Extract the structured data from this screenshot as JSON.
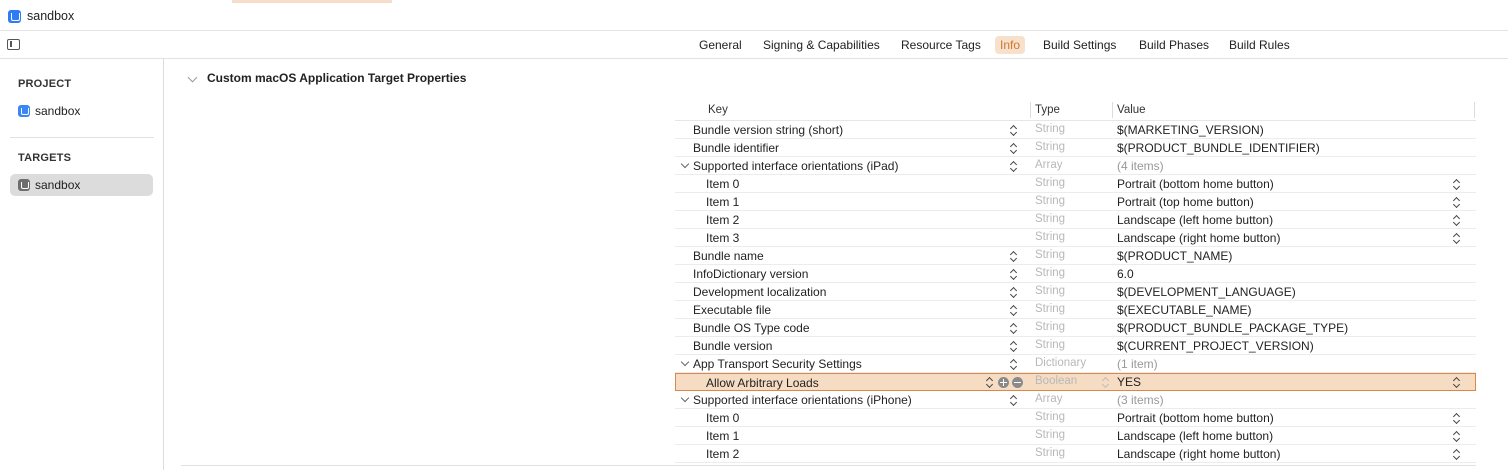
{
  "window": {
    "title": "sandbox"
  },
  "tabs": [
    {
      "label": "General"
    },
    {
      "label": "Signing & Capabilities"
    },
    {
      "label": "Resource Tags"
    },
    {
      "label": "Info"
    },
    {
      "label": "Build Settings"
    },
    {
      "label": "Build Phases"
    },
    {
      "label": "Build Rules"
    }
  ],
  "sidebar": {
    "project_header": "PROJECT",
    "project_item": "sandbox",
    "targets_header": "TARGETS",
    "target_item": "sandbox"
  },
  "section": {
    "title": "Custom macOS Application Target Properties"
  },
  "table": {
    "headers": {
      "key": "Key",
      "type": "Type",
      "value": "Value"
    },
    "rows": [
      {
        "key": "Bundle version string (short)",
        "type": "String",
        "value": "$(MARKETING_VERSION)"
      },
      {
        "key": "Bundle identifier",
        "type": "String",
        "value": "$(PRODUCT_BUNDLE_IDENTIFIER)"
      },
      {
        "key": "Supported interface orientations (iPad)",
        "type": "Array",
        "value": "(4 items)"
      },
      {
        "key": "Item 0",
        "type": "String",
        "value": "Portrait (bottom home button)"
      },
      {
        "key": "Item 1",
        "type": "String",
        "value": "Portrait (top home button)"
      },
      {
        "key": "Item 2",
        "type": "String",
        "value": "Landscape (left home button)"
      },
      {
        "key": "Item 3",
        "type": "String",
        "value": "Landscape (right home button)"
      },
      {
        "key": "Bundle name",
        "type": "String",
        "value": "$(PRODUCT_NAME)"
      },
      {
        "key": "InfoDictionary version",
        "type": "String",
        "value": "6.0"
      },
      {
        "key": "Development localization",
        "type": "String",
        "value": "$(DEVELOPMENT_LANGUAGE)"
      },
      {
        "key": "Executable file",
        "type": "String",
        "value": "$(EXECUTABLE_NAME)"
      },
      {
        "key": "Bundle OS Type code",
        "type": "String",
        "value": "$(PRODUCT_BUNDLE_PACKAGE_TYPE)"
      },
      {
        "key": "Bundle version",
        "type": "String",
        "value": "$(CURRENT_PROJECT_VERSION)"
      },
      {
        "key": "App Transport Security Settings",
        "type": "Dictionary",
        "value": "(1 item)"
      },
      {
        "key": "Allow Arbitrary Loads",
        "type": "Boolean",
        "value": "YES"
      },
      {
        "key": "Supported interface orientations (iPhone)",
        "type": "Array",
        "value": "(3 items)"
      },
      {
        "key": "Item 0",
        "type": "String",
        "value": "Portrait (bottom home button)"
      },
      {
        "key": "Item 1",
        "type": "String",
        "value": "Landscape (left home button)"
      },
      {
        "key": "Item 2",
        "type": "String",
        "value": "Landscape (right home button)"
      }
    ]
  },
  "colors": {
    "accent": "#d1772b",
    "selection": "#f7dcc4",
    "app_icon": "#2d7cf6"
  }
}
